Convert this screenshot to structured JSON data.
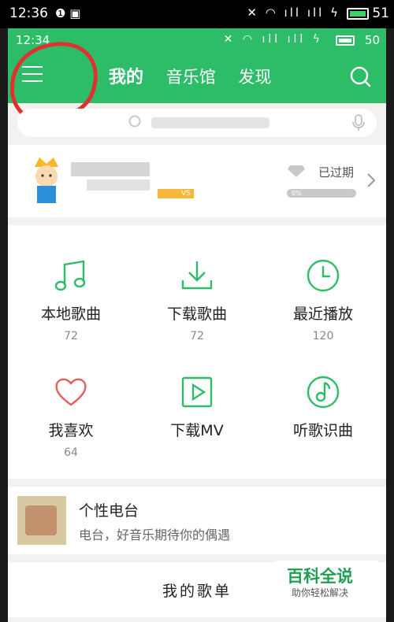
{
  "outer_status": {
    "time": "12:36",
    "battery": "51"
  },
  "status_bar": {
    "time": "12:34",
    "battery": "50"
  },
  "header": {
    "tabs": [
      {
        "label": "我的",
        "active": true
      },
      {
        "label": "音乐馆",
        "active": false
      },
      {
        "label": "发现",
        "active": false
      }
    ]
  },
  "profile": {
    "vip_badge": "VS",
    "expire_status": "已过期",
    "progress_text": "0%",
    "progress": 0
  },
  "grid": [
    {
      "label": "本地歌曲",
      "count": "72",
      "icon": "music-note-icon"
    },
    {
      "label": "下载歌曲",
      "count": "72",
      "icon": "download-icon"
    },
    {
      "label": "最近播放",
      "count": "120",
      "icon": "clock-icon"
    },
    {
      "label": "我喜欢",
      "count": "64",
      "icon": "heart-icon"
    },
    {
      "label": "下载MV",
      "count": "",
      "icon": "video-play-icon"
    },
    {
      "label": "听歌识曲",
      "count": "",
      "icon": "music-recognize-icon"
    }
  ],
  "radio": {
    "title": "个性电台",
    "subtitle": "电台，好音乐期待你的偶遇"
  },
  "playlist": {
    "title": "我的歌单"
  },
  "watermark": {
    "title": "百科全说",
    "subtitle": "助你轻松解决"
  },
  "colors": {
    "brand": "#2dbd68",
    "annotation": "#e03030",
    "favorite": "#e06060"
  }
}
